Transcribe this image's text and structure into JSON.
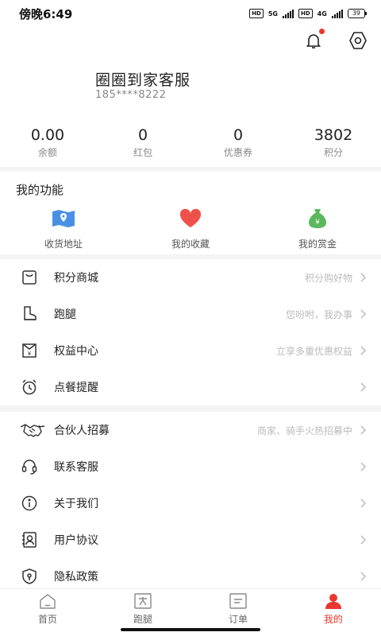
{
  "status": {
    "time": "傍晚6:49",
    "hd1": "HD",
    "net1": "5G",
    "hd2": "HD",
    "net2": "4G",
    "battery": "39"
  },
  "header": {
    "user_name": "圈圈到家客服",
    "phone": "185****8222",
    "has_notification": true
  },
  "stats": [
    {
      "value": "0.00",
      "label": "余额"
    },
    {
      "value": "0",
      "label": "红包"
    },
    {
      "value": "0",
      "label": "优惠券"
    },
    {
      "value": "3802",
      "label": "积分"
    }
  ],
  "functions": {
    "title": "我的功能",
    "items": [
      {
        "label": "收货地址",
        "icon": "map-pin-icon"
      },
      {
        "label": "我的收藏",
        "icon": "heart-icon"
      },
      {
        "label": "我的赏金",
        "icon": "money-bag-icon"
      }
    ]
  },
  "menu_group1": [
    {
      "label": "积分商城",
      "hint": "积分购好物",
      "icon": "shopping-bag-icon"
    },
    {
      "label": "跑腿",
      "hint": "您吩咐，我办事",
      "icon": "boot-icon"
    },
    {
      "label": "权益中心",
      "hint": "立享多重优惠权益",
      "icon": "coupon-icon"
    },
    {
      "label": "点餐提醒",
      "hint": "",
      "icon": "alarm-clock-icon"
    }
  ],
  "menu_group2": [
    {
      "label": "合伙人招募",
      "hint": "商家、骑手火热招募中",
      "icon": "handshake-icon"
    },
    {
      "label": "联系客服",
      "hint": "",
      "icon": "headset-icon"
    },
    {
      "label": "关于我们",
      "hint": "",
      "icon": "info-icon"
    },
    {
      "label": "用户协议",
      "hint": "",
      "icon": "user-card-icon"
    },
    {
      "label": "隐私政策",
      "hint": "",
      "icon": "shield-icon"
    }
  ],
  "tabs": [
    {
      "label": "首页",
      "icon": "home-icon"
    },
    {
      "label": "跑腿",
      "icon": "errand-icon"
    },
    {
      "label": "订单",
      "icon": "order-icon"
    },
    {
      "label": "我的",
      "icon": "user-icon",
      "active": true
    }
  ],
  "colors": {
    "accent": "#e8382f",
    "map_blue": "#4a90e2",
    "heart_red": "#f0504a",
    "money_green": "#5cb85c"
  }
}
